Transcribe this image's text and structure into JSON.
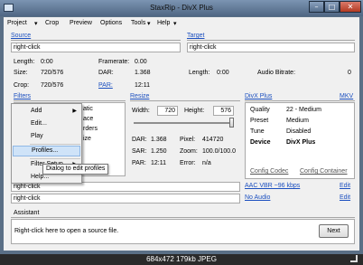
{
  "window": {
    "title": "StaxRip - DivX Plus"
  },
  "menu": [
    "Project",
    "Crop",
    "Preview",
    "Options",
    "Tools",
    "Help"
  ],
  "source": {
    "title": "Source",
    "file_value": "right-click",
    "length_label": "Length:",
    "length_value": "0:00",
    "size_label": "Size:",
    "size_value": "720/576",
    "crop_label": "Crop:",
    "crop_value": "720/576",
    "framerate_label": "Framerate:",
    "framerate_value": "0.00",
    "dar_label": "DAR:",
    "dar_value": "1.368",
    "par_label": "PAR:",
    "par_value": "12:11"
  },
  "target": {
    "title": "Target",
    "file_value": "right-click",
    "length_label": "Length:",
    "length_value": "0:00",
    "audio_bitrate_label": "Audio Bitrate:",
    "audio_bitrate_value": "0"
  },
  "filters": {
    "title": "Filters",
    "visible_item_fragments": [
      "atic",
      "ace",
      "rders",
      "ize"
    ]
  },
  "resize": {
    "title": "Resize",
    "width_label": "Width:",
    "width_value": "720",
    "height_label": "Height:",
    "height_value": "576",
    "dar_label": "DAR:",
    "dar_value": "1.368",
    "pixel_label": "Pixel:",
    "pixel_value": "414720",
    "sar_label": "SAR:",
    "sar_value": "1.250",
    "zoom_label": "Zoom:",
    "zoom_value": "100.0/100.0",
    "par_label": "PAR:",
    "par_value": "12:11",
    "error_label": "Error:",
    "error_value": "n/a",
    "slider_level": 1.0
  },
  "profile": {
    "title": "DivX Plus",
    "mkv_link": "MKV",
    "quality_label": "Quality",
    "quality_value": "22 - Medium",
    "preset_label": "Preset",
    "preset_value": "Medium",
    "tune_label": "Tune",
    "tune_value": "Disabled",
    "device_label": "Device",
    "device_value": "DivX Plus",
    "config_codec": "Config Codec",
    "config_container": "Config Container"
  },
  "audio": {
    "track1_value": "right-click",
    "track1_codec": "AAC VBR ~96 kbps",
    "track1_edit": "Edit",
    "track2_value": "right-click",
    "track2_codec": "No Audio",
    "track2_edit": "Edit"
  },
  "assistant": {
    "title": "Assistant",
    "message": "Right-click here to open a source file.",
    "next_button": "Next"
  },
  "context_menu": {
    "items": [
      {
        "label": "Add",
        "submenu": true
      },
      {
        "label": "Edit...",
        "submenu": false
      },
      {
        "label": "Play",
        "submenu": false
      },
      {
        "label": "Profiles...",
        "submenu": false
      },
      {
        "label": "Filter Setup",
        "submenu": true
      },
      {
        "label": "Help...",
        "submenu": false
      }
    ],
    "highlighted_index": 3,
    "tooltip": "Dialog to edit profiles"
  },
  "footer": {
    "caption": "684x472 179kb JPEG"
  }
}
